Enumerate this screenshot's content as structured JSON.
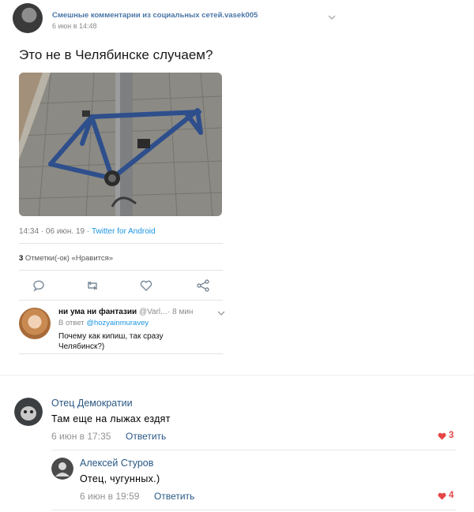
{
  "post": {
    "author": "Смешные комментарии из социальных сетей.vasek005",
    "date": "6 июн в 14:48"
  },
  "tweet": {
    "text": "Это не в Челябинске случаем?",
    "meta_time": "14:34 · 06 июн. 19 · ",
    "meta_source": "Twitter for Android",
    "likes_count": "3",
    "likes_label": " Отметки(-ок) «Нравится»",
    "actions": [
      "comment-icon",
      "retweet-icon",
      "heart-icon",
      "share-icon"
    ]
  },
  "tweet_reply": {
    "name": "ни ума ни фантазии",
    "handle": " @Varl...",
    "time": "· 8 мин",
    "reply_prefix": "В ответ ",
    "reply_handle": "@hozyainmuravey",
    "text": "Почему как кипиш, так сразу Челябинск?)"
  },
  "comments": [
    {
      "author": "Отец Демократии",
      "text": "Там еще на лыжах ездят",
      "date": "6 июн в 17:35",
      "reply_label": "Ответить",
      "likes": "3"
    },
    {
      "author": "Алексей Стуров",
      "text": "Отец, чугунных.)",
      "date": "6 июн в 19:59",
      "reply_label": "Ответить",
      "likes": "4"
    }
  ],
  "colors": {
    "vk_link": "#2a5885",
    "twitter_blue": "#1b95e0",
    "like_red": "#e64646",
    "bike_blue": "#2e4f8c"
  }
}
